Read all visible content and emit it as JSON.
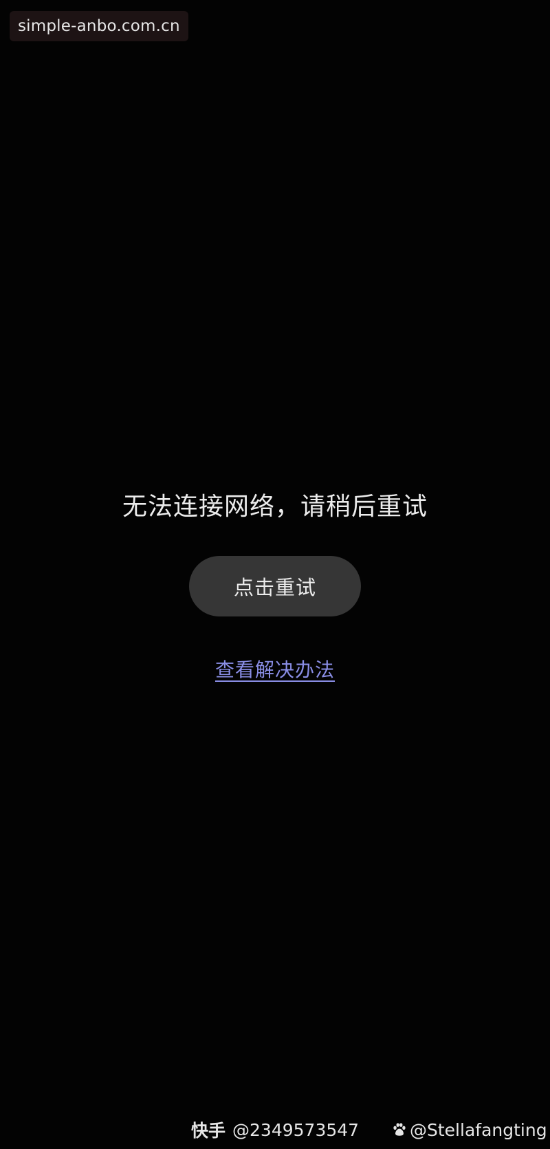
{
  "site_badge": {
    "text": "simple-anbo.com.cn"
  },
  "error": {
    "message": "无法连接网络，请稍后重试",
    "retry_label": "点击重试",
    "solution_link": "查看解决办法"
  },
  "colors": {
    "background": "#030303",
    "button_bg": "#363636",
    "link": "#8a8ee6"
  },
  "watermarks": {
    "kuaishou_brand": "快手",
    "kuaishou_handle": "@2349573547",
    "weibo_icon": "paw-icon",
    "weibo_handle": "@Stellafangting"
  }
}
